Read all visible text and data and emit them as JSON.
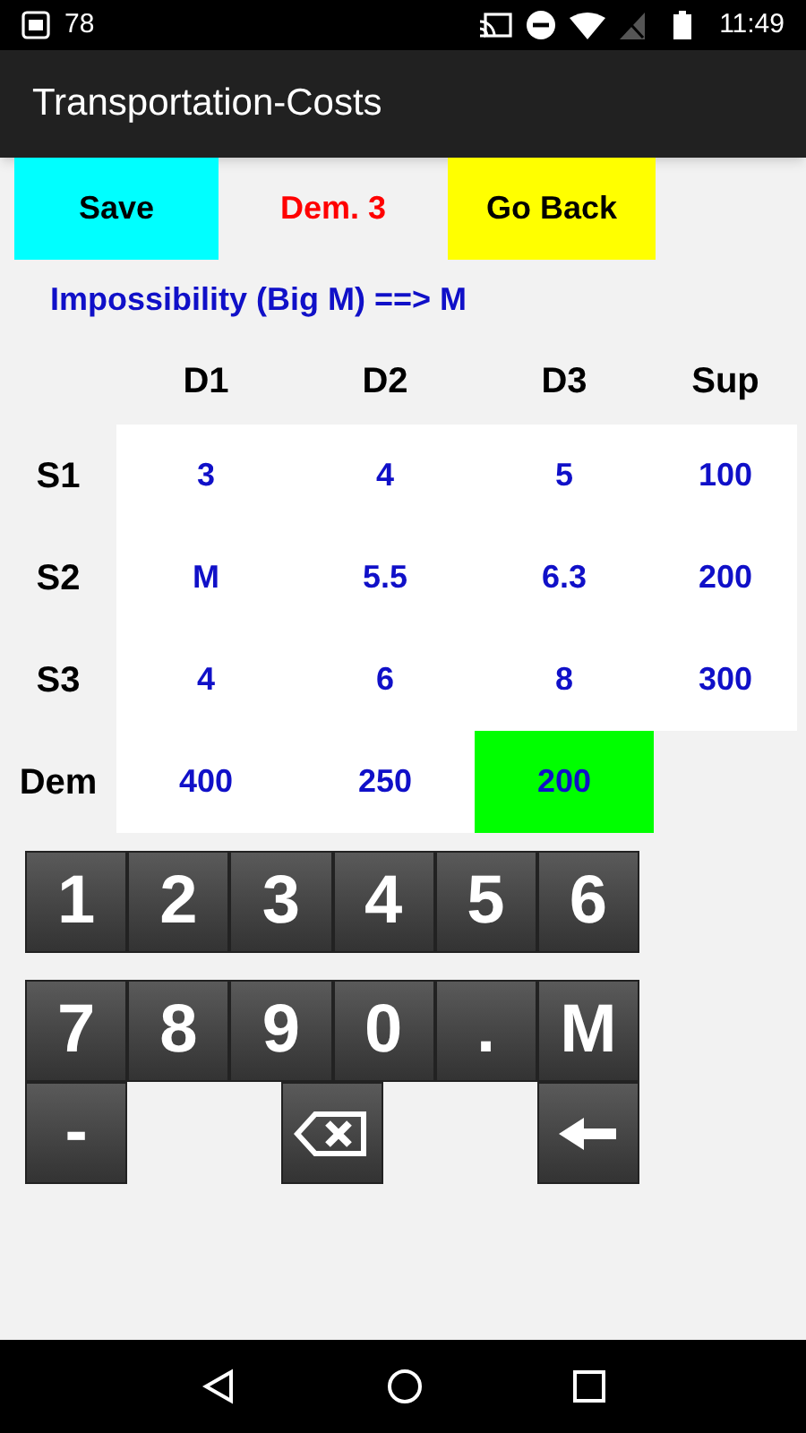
{
  "status_bar": {
    "notification_count": "78",
    "time": "11:49"
  },
  "app_bar": {
    "title": "Transportation-Costs"
  },
  "toolbar": {
    "save": "Save",
    "current_cell": "Dem. 3",
    "back": "Go Back"
  },
  "hint": "Impossibility (Big M) ==> M",
  "table": {
    "columns": [
      "D1",
      "D2",
      "D3",
      "Sup"
    ],
    "rows": [
      {
        "label": "S1",
        "cells": [
          {
            "text": "3",
            "selected": false
          },
          {
            "text": "4",
            "selected": false
          },
          {
            "text": "5",
            "selected": false
          },
          {
            "text": "100",
            "selected": false
          }
        ]
      },
      {
        "label": "S2",
        "cells": [
          {
            "text": "M",
            "selected": false
          },
          {
            "text": "5.5",
            "selected": false
          },
          {
            "text": "6.3",
            "selected": false
          },
          {
            "text": "200",
            "selected": false
          }
        ]
      },
      {
        "label": "S3",
        "cells": [
          {
            "text": "4",
            "selected": false
          },
          {
            "text": "6",
            "selected": false
          },
          {
            "text": "8",
            "selected": false
          },
          {
            "text": "300",
            "selected": false
          }
        ]
      },
      {
        "label": "Dem",
        "cells": [
          {
            "text": "400",
            "selected": false
          },
          {
            "text": "250",
            "selected": false
          },
          {
            "text": "200",
            "selected": true
          }
        ]
      }
    ]
  },
  "keypad": {
    "rows": [
      [
        {
          "kind": "text",
          "label": "1"
        },
        {
          "kind": "text",
          "label": "2"
        },
        {
          "kind": "text",
          "label": "3"
        },
        {
          "kind": "text",
          "label": "4"
        },
        {
          "kind": "text",
          "label": "5"
        },
        {
          "kind": "text",
          "label": "6"
        }
      ],
      [
        {
          "kind": "text",
          "label": "7"
        },
        {
          "kind": "text",
          "label": "8"
        },
        {
          "kind": "text",
          "label": "9"
        },
        {
          "kind": "text",
          "label": "0"
        },
        {
          "kind": "text",
          "label": "."
        },
        {
          "kind": "text",
          "label": "M"
        }
      ],
      [
        {
          "kind": "text",
          "label": "-"
        },
        {
          "kind": "backspace"
        },
        {
          "kind": "enter"
        }
      ]
    ]
  }
}
